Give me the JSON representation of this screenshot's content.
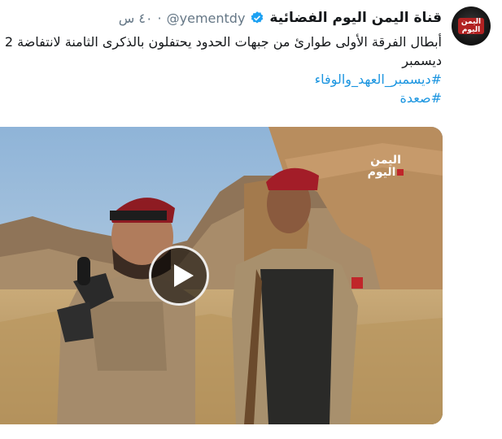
{
  "tweet": {
    "display_name": "قناة اليمن اليوم الفضائية",
    "handle": "@yementdy",
    "separator": "·",
    "time": "٤٠ س",
    "text_line1": "أبطال الفرقة الأولى طوارئ من جبهات الحدود يحتفلون بالذكرى الثامنة لانتفاضة 2",
    "text_line2": "ديسمبر",
    "hashtags": [
      "#ديسمبر_العهد_والوفاء",
      "#صعدة"
    ]
  },
  "avatar": {
    "logo_text_top": "اليمن",
    "logo_text_bottom": "اليوم"
  },
  "media": {
    "type": "video",
    "watermark_top": "اليمن",
    "watermark_bottom": "اليوم",
    "play_icon": "play-icon"
  },
  "colors": {
    "link": "#1b95e0",
    "verified": "#1da1f2",
    "muted": "#657786",
    "text": "#14171a"
  }
}
